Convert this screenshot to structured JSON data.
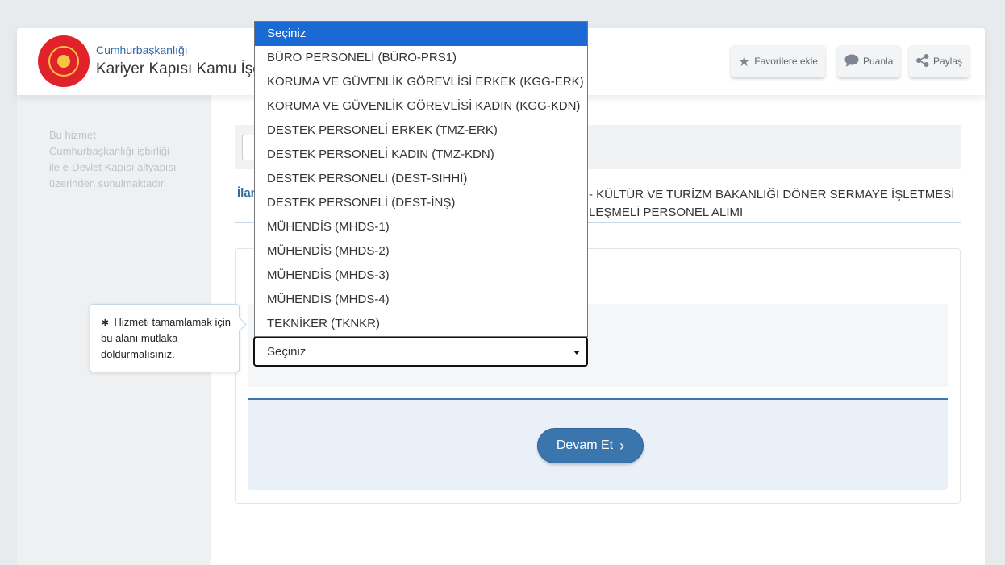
{
  "header": {
    "brand_small": "Cumhurbaşkanlığı",
    "brand_title": "Kariyer Kapısı Kamu İşe",
    "buttons": [
      {
        "label": "Favorilere ekle",
        "icon": "star-icon"
      },
      {
        "label": "Puanla",
        "icon": "speech-bubble-icon"
      },
      {
        "label": "Paylaş",
        "icon": "share-icon"
      }
    ]
  },
  "sidebar": {
    "info_text": "Bu hizmet Cumhurbaşkanlığı işbirliği ile e-Devlet Kapısı altyapısı üzerinden sunulmaktadır."
  },
  "listing": {
    "label": "İlan",
    "text_line1": "- KÜLTÜR VE TURİZM BAKANLIĞI DÖNER SERMAYE İŞLETMESİ",
    "text_line2": "LEŞMELİ PERSONEL ALIMI"
  },
  "tooltip": {
    "star": "∗",
    "text": "Hizmeti tamamlamak için bu alanı mutlaka doldurmalısınız."
  },
  "select": {
    "value": "Seçiniz",
    "options": [
      "Seçiniz",
      "BÜRO PERSONELİ (BÜRO-PRS1)",
      "KORUMA VE GÜVENLİK GÖREVLİSİ ERKEK (KGG-ERK)",
      "KORUMA VE GÜVENLİK GÖREVLİSİ KADIN (KGG-KDN)",
      "DESTEK PERSONELİ ERKEK (TMZ-ERK)",
      "DESTEK PERSONELİ KADIN (TMZ-KDN)",
      "DESTEK PERSONELİ (DEST-SIHHİ)",
      "DESTEK PERSONELİ (DEST-İNŞ)",
      "MÜHENDİS (MHDS-1)",
      "MÜHENDİS (MHDS-2)",
      "MÜHENDİS (MHDS-3)",
      "MÜHENDİS (MHDS-4)",
      "TEKNİKER (TKNKR)"
    ],
    "highlighted_index": 0
  },
  "actions": {
    "continue_label": "Devam Et",
    "continue_icon": "chevron-right-icon"
  },
  "colors": {
    "accent": "#3a76ad",
    "highlight": "#1b6ad3",
    "seal_red": "#e1222a",
    "seal_gold": "#f6c545"
  }
}
